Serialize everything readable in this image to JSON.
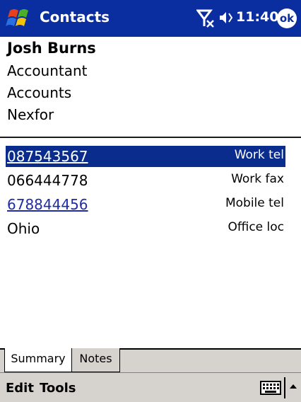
{
  "titlebar": {
    "app_title": "Contacts",
    "time": "11:40",
    "ok_label": "ok",
    "icons": [
      "windows-start-icon",
      "signal-off-icon",
      "volume-icon"
    ]
  },
  "contact": {
    "name": "Josh Burns",
    "job_title": "Accountant",
    "department": "Accounts",
    "company": "Nexfor"
  },
  "details": [
    {
      "value": "087543567",
      "label": "Work tel",
      "link": true,
      "selected": true
    },
    {
      "value": "066444778",
      "label": "Work fax",
      "link": false,
      "selected": false
    },
    {
      "value": "678844456",
      "label": "Mobile tel",
      "link": true,
      "selected": false
    },
    {
      "value": "Ohio",
      "label": "Office loc",
      "link": false,
      "selected": false
    }
  ],
  "tabs": [
    {
      "label": "Summary",
      "active": true
    },
    {
      "label": "Notes",
      "active": false
    }
  ],
  "menubar": {
    "edit_label": "Edit",
    "tools_label": "Tools",
    "icons": [
      "keyboard-icon",
      "sip-arrow-up-icon"
    ]
  },
  "colors": {
    "titlebar_bg": "#0a2ea0",
    "selection_bg": "#0a2c8c",
    "link": "#1f2ca6",
    "menubar_bg": "#d6d3ce"
  }
}
